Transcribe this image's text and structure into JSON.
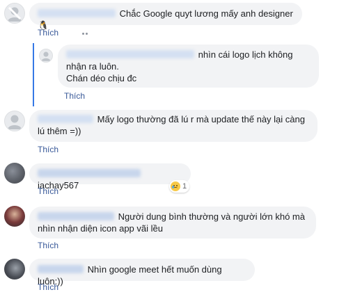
{
  "comments": [
    {
      "text": "Chắc Google quyt lương mấy anh designer",
      "emoji": "🐧",
      "like": "Thích"
    },
    {
      "text": "nhìn cái logo lịch không nhận ra luôn.",
      "text2": "Chán déo chịu đc",
      "like": "Thích"
    },
    {
      "text": "Mấy logo thường đã lú r mà update thế này lại càng lú thêm =))",
      "like": "Thích"
    },
    {
      "text": "iachay567",
      "like": "Thích",
      "reaction_count": "1"
    },
    {
      "text": "Người dung bình thường và người lớn khó mà nhìn nhận diện icon app vãi lều",
      "like": "Thích"
    },
    {
      "text": "Nhìn google meet hết muốn dùng luôn:))",
      "like": "Thích"
    }
  ],
  "icons": {
    "default_avatar": "person-silhouette-icon",
    "more": "more-dots-icon",
    "reaction": "sad-reaction-icon"
  }
}
